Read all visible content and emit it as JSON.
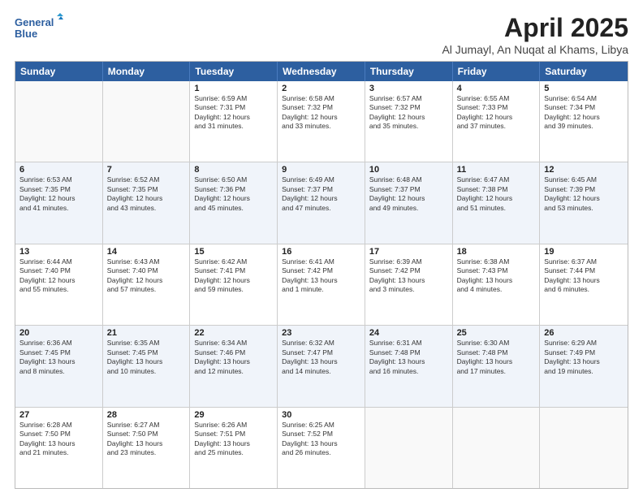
{
  "header": {
    "logo_line1": "General",
    "logo_line2": "Blue",
    "title": "April 2025",
    "location": "Al Jumayl, An Nuqat al Khams, Libya"
  },
  "days_of_week": [
    "Sunday",
    "Monday",
    "Tuesday",
    "Wednesday",
    "Thursday",
    "Friday",
    "Saturday"
  ],
  "weeks": [
    [
      {
        "day": "",
        "info": ""
      },
      {
        "day": "",
        "info": ""
      },
      {
        "day": "1",
        "info": "Sunrise: 6:59 AM\nSunset: 7:31 PM\nDaylight: 12 hours\nand 31 minutes."
      },
      {
        "day": "2",
        "info": "Sunrise: 6:58 AM\nSunset: 7:32 PM\nDaylight: 12 hours\nand 33 minutes."
      },
      {
        "day": "3",
        "info": "Sunrise: 6:57 AM\nSunset: 7:32 PM\nDaylight: 12 hours\nand 35 minutes."
      },
      {
        "day": "4",
        "info": "Sunrise: 6:55 AM\nSunset: 7:33 PM\nDaylight: 12 hours\nand 37 minutes."
      },
      {
        "day": "5",
        "info": "Sunrise: 6:54 AM\nSunset: 7:34 PM\nDaylight: 12 hours\nand 39 minutes."
      }
    ],
    [
      {
        "day": "6",
        "info": "Sunrise: 6:53 AM\nSunset: 7:35 PM\nDaylight: 12 hours\nand 41 minutes."
      },
      {
        "day": "7",
        "info": "Sunrise: 6:52 AM\nSunset: 7:35 PM\nDaylight: 12 hours\nand 43 minutes."
      },
      {
        "day": "8",
        "info": "Sunrise: 6:50 AM\nSunset: 7:36 PM\nDaylight: 12 hours\nand 45 minutes."
      },
      {
        "day": "9",
        "info": "Sunrise: 6:49 AM\nSunset: 7:37 PM\nDaylight: 12 hours\nand 47 minutes."
      },
      {
        "day": "10",
        "info": "Sunrise: 6:48 AM\nSunset: 7:37 PM\nDaylight: 12 hours\nand 49 minutes."
      },
      {
        "day": "11",
        "info": "Sunrise: 6:47 AM\nSunset: 7:38 PM\nDaylight: 12 hours\nand 51 minutes."
      },
      {
        "day": "12",
        "info": "Sunrise: 6:45 AM\nSunset: 7:39 PM\nDaylight: 12 hours\nand 53 minutes."
      }
    ],
    [
      {
        "day": "13",
        "info": "Sunrise: 6:44 AM\nSunset: 7:40 PM\nDaylight: 12 hours\nand 55 minutes."
      },
      {
        "day": "14",
        "info": "Sunrise: 6:43 AM\nSunset: 7:40 PM\nDaylight: 12 hours\nand 57 minutes."
      },
      {
        "day": "15",
        "info": "Sunrise: 6:42 AM\nSunset: 7:41 PM\nDaylight: 12 hours\nand 59 minutes."
      },
      {
        "day": "16",
        "info": "Sunrise: 6:41 AM\nSunset: 7:42 PM\nDaylight: 13 hours\nand 1 minute."
      },
      {
        "day": "17",
        "info": "Sunrise: 6:39 AM\nSunset: 7:42 PM\nDaylight: 13 hours\nand 3 minutes."
      },
      {
        "day": "18",
        "info": "Sunrise: 6:38 AM\nSunset: 7:43 PM\nDaylight: 13 hours\nand 4 minutes."
      },
      {
        "day": "19",
        "info": "Sunrise: 6:37 AM\nSunset: 7:44 PM\nDaylight: 13 hours\nand 6 minutes."
      }
    ],
    [
      {
        "day": "20",
        "info": "Sunrise: 6:36 AM\nSunset: 7:45 PM\nDaylight: 13 hours\nand 8 minutes."
      },
      {
        "day": "21",
        "info": "Sunrise: 6:35 AM\nSunset: 7:45 PM\nDaylight: 13 hours\nand 10 minutes."
      },
      {
        "day": "22",
        "info": "Sunrise: 6:34 AM\nSunset: 7:46 PM\nDaylight: 13 hours\nand 12 minutes."
      },
      {
        "day": "23",
        "info": "Sunrise: 6:32 AM\nSunset: 7:47 PM\nDaylight: 13 hours\nand 14 minutes."
      },
      {
        "day": "24",
        "info": "Sunrise: 6:31 AM\nSunset: 7:48 PM\nDaylight: 13 hours\nand 16 minutes."
      },
      {
        "day": "25",
        "info": "Sunrise: 6:30 AM\nSunset: 7:48 PM\nDaylight: 13 hours\nand 17 minutes."
      },
      {
        "day": "26",
        "info": "Sunrise: 6:29 AM\nSunset: 7:49 PM\nDaylight: 13 hours\nand 19 minutes."
      }
    ],
    [
      {
        "day": "27",
        "info": "Sunrise: 6:28 AM\nSunset: 7:50 PM\nDaylight: 13 hours\nand 21 minutes."
      },
      {
        "day": "28",
        "info": "Sunrise: 6:27 AM\nSunset: 7:50 PM\nDaylight: 13 hours\nand 23 minutes."
      },
      {
        "day": "29",
        "info": "Sunrise: 6:26 AM\nSunset: 7:51 PM\nDaylight: 13 hours\nand 25 minutes."
      },
      {
        "day": "30",
        "info": "Sunrise: 6:25 AM\nSunset: 7:52 PM\nDaylight: 13 hours\nand 26 minutes."
      },
      {
        "day": "",
        "info": ""
      },
      {
        "day": "",
        "info": ""
      },
      {
        "day": "",
        "info": ""
      }
    ]
  ]
}
